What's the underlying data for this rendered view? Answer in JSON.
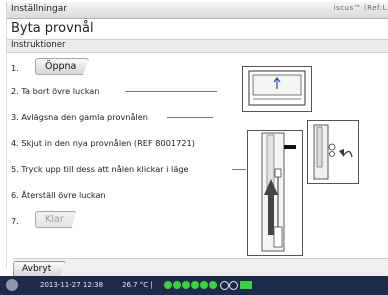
{
  "window": {
    "title": "Inställningar",
    "brand": "iscus™ (Ref:L"
  },
  "page": {
    "title": "Byta provnål",
    "subtitle": "Instruktioner"
  },
  "steps": {
    "s1": {
      "number": "1.",
      "button": "Öppna"
    },
    "s2": "2. Ta bort övre luckan",
    "s3": "3. Avlägsna den gamla provnålen",
    "s4": "4. Skjut in den nya provnålen (REF 8001721)",
    "s5": "5. Tryck upp till dess att nålen klickar i läge",
    "s6": "6. Återställ övre luckan",
    "s7": {
      "number": "7.",
      "button": "Klar"
    }
  },
  "footer": {
    "cancel": "Avbryt"
  },
  "statusbar": {
    "datetime": "2013-11-27 12:38",
    "temperature": "26.7 °C  |"
  },
  "colors": {
    "status_bg": "#1e2a4a",
    "indicator_green": "#3ed13e"
  },
  "icons": [
    "app-logo-icon",
    "status-indicator-icon",
    "battery-icon"
  ]
}
